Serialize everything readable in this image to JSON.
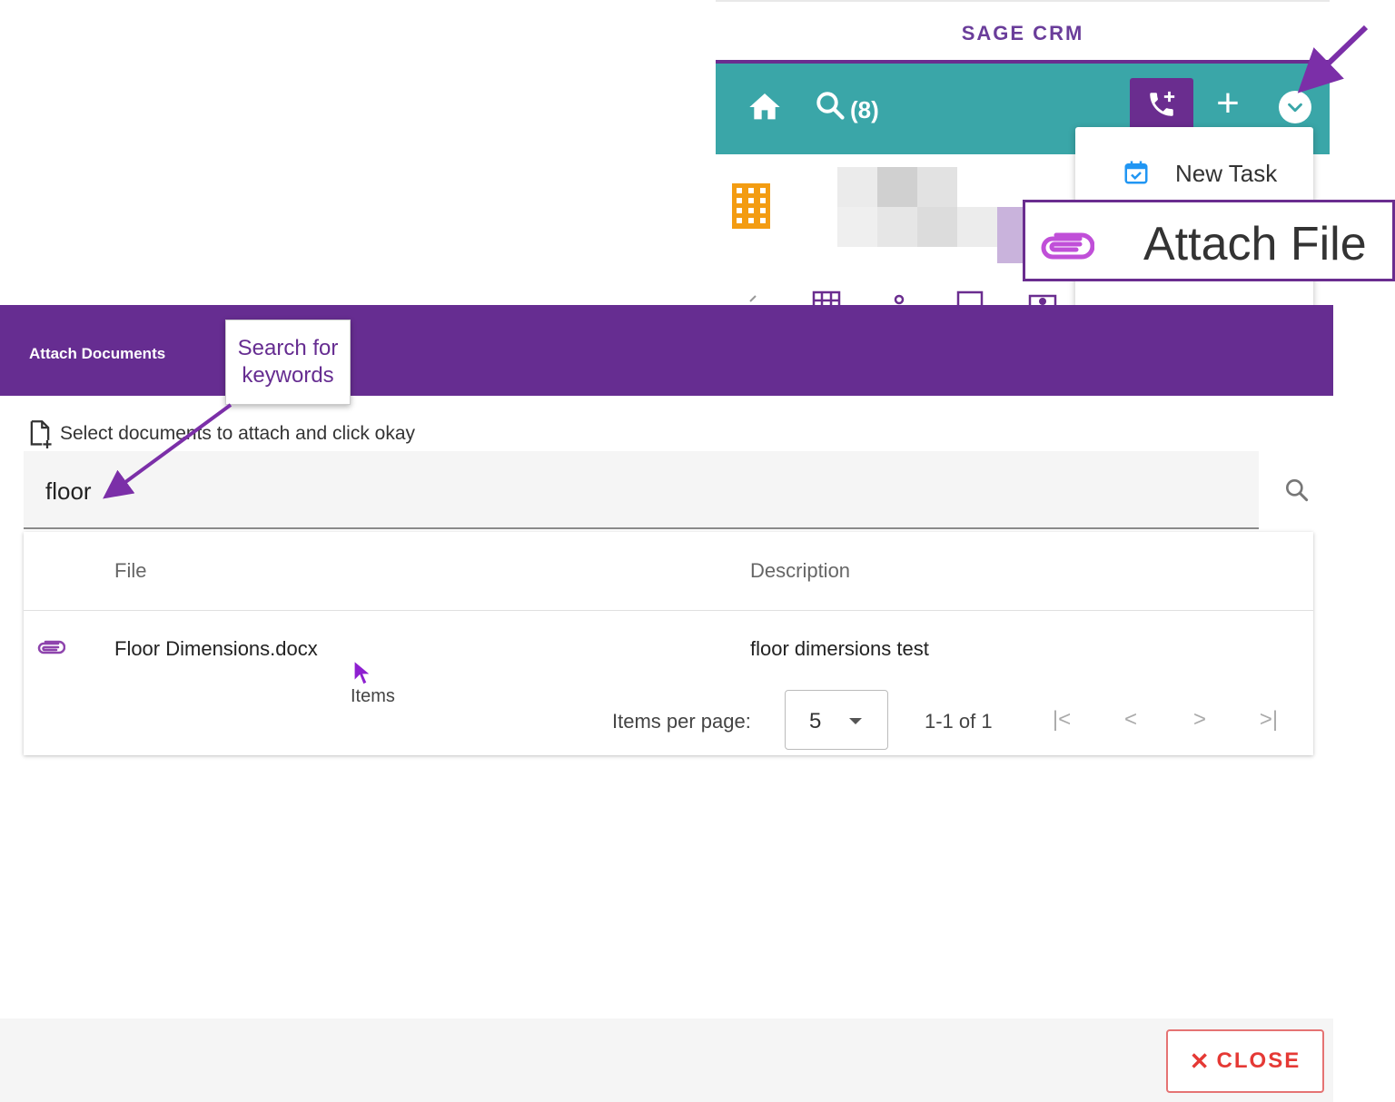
{
  "crm": {
    "title": "SAGE CRM",
    "search_count": "(8)",
    "menu": {
      "new_task": "New Task",
      "attach_file": "Attach File"
    }
  },
  "dialog": {
    "title": "Attach Documents",
    "instruction": "Select documents to attach and click okay",
    "search_value": "floor",
    "columns": {
      "file": "File",
      "description": "Description"
    },
    "rows": [
      {
        "file": "Floor Dimensions.docx",
        "description": "floor dimersions test"
      }
    ],
    "ghost_text": "Items",
    "paginator": {
      "items_per_page_label": "Items per page:",
      "page_size": "5",
      "range": "1-1 of 1"
    },
    "close_label": "CLOSE"
  },
  "annotations": {
    "search_callout": "Search for keywords"
  },
  "colors": {
    "purple": "#662d91",
    "teal": "#3aa6a8",
    "close_red": "#e53935"
  }
}
